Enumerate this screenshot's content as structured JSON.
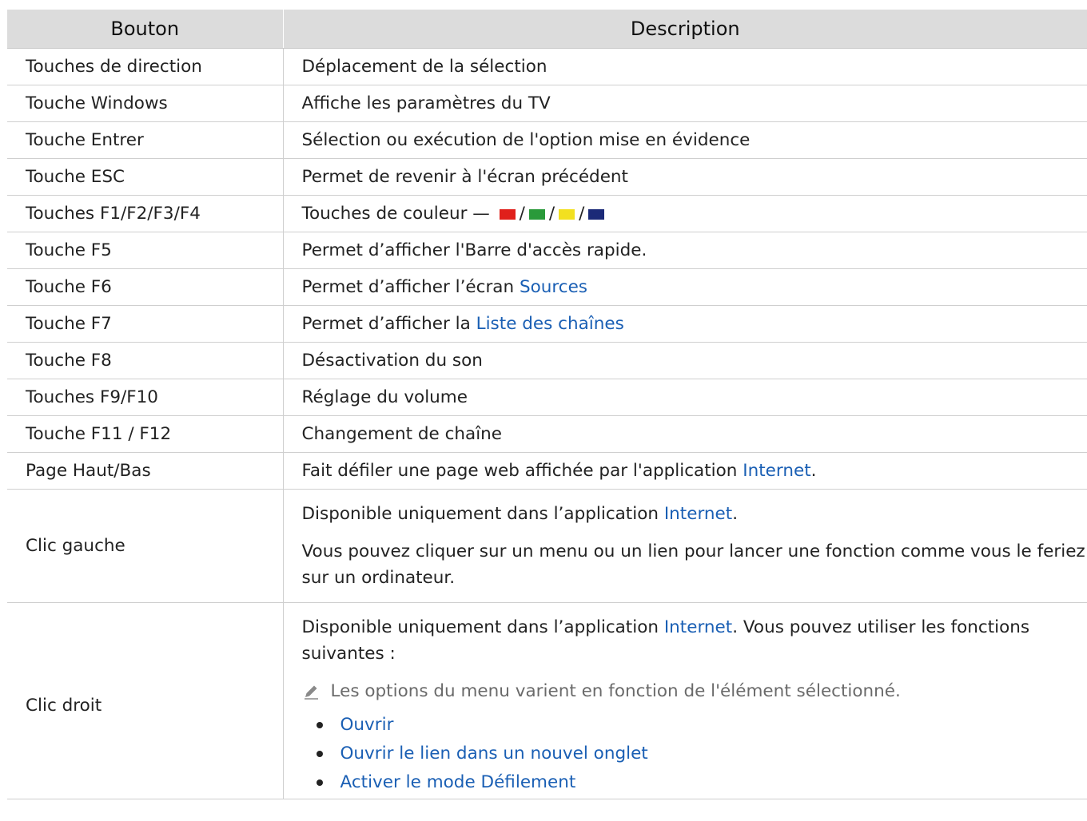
{
  "table": {
    "headers": {
      "button": "Bouton",
      "description": "Description"
    },
    "rows": [
      {
        "button": "Touches de direction",
        "description": "Déplacement de la sélection"
      },
      {
        "button": "Touche Windows",
        "description": "Affiche les paramètres du TV"
      },
      {
        "button": "Touche Entrer",
        "description": "Sélection ou exécution de l'option mise en évidence"
      },
      {
        "button": "Touche ESC",
        "description": "Permet de revenir à l'écran précédent"
      },
      {
        "button": "Touches F1/F2/F3/F4",
        "description_prefix": "Touches de couleur —",
        "separator": "/",
        "swatch_colors": [
          "#e0201b",
          "#2a9a3a",
          "#f2e020",
          "#1b2a78"
        ]
      },
      {
        "button": "Touche F5",
        "description": "Permet d’afficher l'Barre d'accès rapide."
      },
      {
        "button": "Touche F6",
        "description_prefix": "Permet d’afficher l’écran",
        "link": "Sources"
      },
      {
        "button": "Touche F7",
        "description_prefix": "Permet d’afficher la",
        "link": "Liste des chaînes"
      },
      {
        "button": "Touche F8",
        "description": "Désactivation du son"
      },
      {
        "button": "Touches F9/F10",
        "description": "Réglage du volume"
      },
      {
        "button": "Touche F11 / F12",
        "description": "Changement de chaîne"
      },
      {
        "button": "Page Haut/Bas",
        "description_prefix": "Fait défiler une page web affichée par l'application",
        "link": "Internet",
        "description_suffix": "."
      },
      {
        "button": "Clic gauche",
        "p1_prefix": "Disponible uniquement dans l’application",
        "p1_link": "Internet",
        "p1_suffix": ".",
        "p2": "Vous pouvez cliquer sur un menu ou un lien pour lancer une fonction comme vous le feriez sur un ordinateur."
      },
      {
        "button": "Clic droit",
        "p1_prefix": "Disponible uniquement dans l’application",
        "p1_link": "Internet",
        "p1_suffix": ". Vous pouvez utiliser les fonctions suivantes :",
        "note": "Les options du menu varient en fonction de l'élément sélectionné.",
        "note_icon": "pencil-icon",
        "options": [
          "Ouvrir",
          "Ouvrir le lien dans un nouvel onglet",
          "Activer le mode Défilement"
        ]
      }
    ]
  },
  "colors": {
    "link": "#1a5fb4",
    "header_bg": "#dcdcdc",
    "text": "#222222",
    "note_text": "#6a6a6a"
  }
}
